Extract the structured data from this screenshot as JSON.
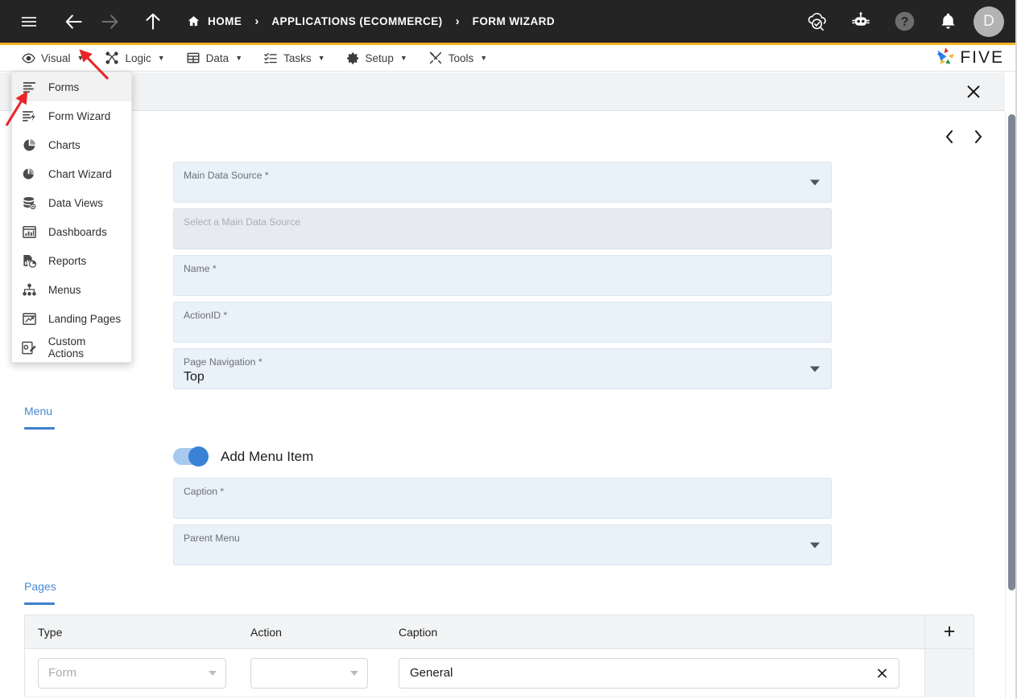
{
  "topbar": {
    "menu_icon": "hamburger-icon",
    "back_icon": "arrow-left-icon",
    "forward_icon": "arrow-right-icon",
    "up_icon": "arrow-up-icon",
    "breadcrumb": [
      {
        "label": "HOME",
        "icon": "home-icon"
      },
      {
        "label": "APPLICATIONS (ECOMMERCE)",
        "icon": ""
      },
      {
        "label": "FORM WIZARD",
        "icon": ""
      }
    ],
    "separator": "›",
    "actions": [
      {
        "name": "cloud-check-icon",
        "label": ""
      },
      {
        "name": "robot-icon",
        "label": ""
      },
      {
        "name": "help-icon",
        "label": ""
      },
      {
        "name": "bell-icon",
        "label": ""
      }
    ],
    "avatar_initial": "D",
    "accent_color": "#f5b325",
    "background_color": "#242424"
  },
  "menubar": {
    "items": [
      {
        "label": "Visual",
        "icon": "eye-icon",
        "caret": "▼"
      },
      {
        "label": "Logic",
        "icon": "logic-nodes-icon",
        "caret": "▼"
      },
      {
        "label": "Data",
        "icon": "table-grid-icon",
        "caret": "▼"
      },
      {
        "label": "Tasks",
        "icon": "checklist-icon",
        "caret": "▼"
      },
      {
        "label": "Setup",
        "icon": "gear-icon",
        "caret": "▼"
      },
      {
        "label": "Tools",
        "icon": "tools-icon",
        "caret": "▼"
      }
    ],
    "brand": "FIVE"
  },
  "dropdown": {
    "open_for": "Visual",
    "items": [
      {
        "label": "Forms",
        "icon": "form-lines-icon",
        "active": true
      },
      {
        "label": "Form Wizard",
        "icon": "form-wizard-icon",
        "active": false
      },
      {
        "label": "Charts",
        "icon": "pie-chart-icon",
        "active": false
      },
      {
        "label": "Chart Wizard",
        "icon": "chart-wizard-icon",
        "active": false
      },
      {
        "label": "Data Views",
        "icon": "database-eye-icon",
        "active": false
      },
      {
        "label": "Dashboards",
        "icon": "dashboard-icon",
        "active": false
      },
      {
        "label": "Reports",
        "icon": "report-icon",
        "active": false
      },
      {
        "label": "Menus",
        "icon": "org-tree-icon",
        "active": false
      },
      {
        "label": "Landing Pages",
        "icon": "landing-page-icon",
        "active": false
      },
      {
        "label": "Custom Actions",
        "icon": "custom-action-icon",
        "active": false
      }
    ]
  },
  "sheet": {
    "close_icon": "close-icon",
    "prev_icon": "chevron-left-icon",
    "next_icon": "chevron-right-icon"
  },
  "form": {
    "fields": [
      {
        "label": "Main Data Source *",
        "value": "",
        "type": "select",
        "disabled": false
      },
      {
        "label": "Select a Main Data Source",
        "value": "",
        "type": "text",
        "disabled": true
      },
      {
        "label": "Name *",
        "value": "",
        "type": "text",
        "disabled": false
      },
      {
        "label": "ActionID *",
        "value": "",
        "type": "text",
        "disabled": false
      },
      {
        "label": "Page Navigation *",
        "value": "Top",
        "type": "select",
        "disabled": false
      }
    ]
  },
  "menu_section": {
    "tab_label": "Menu",
    "toggle_label": "Add Menu Item",
    "toggle_on": true,
    "fields": [
      {
        "label": "Caption *",
        "value": "",
        "type": "text",
        "disabled": false
      },
      {
        "label": "Parent Menu",
        "value": "",
        "type": "select",
        "disabled": false
      }
    ]
  },
  "pages_section": {
    "tab_label": "Pages",
    "add_row_label": "+",
    "columns": [
      "Type",
      "Action",
      "Caption"
    ],
    "rows": [
      {
        "type": "Form",
        "type_is_placeholder": true,
        "action": "",
        "caption": "General",
        "clear_icon": "close-icon"
      }
    ]
  },
  "annotations": [
    {
      "name": "arrow-to-visual-dropdown",
      "color": "#e8262a"
    },
    {
      "name": "arrow-to-forms-item",
      "color": "#e8262a"
    }
  ]
}
